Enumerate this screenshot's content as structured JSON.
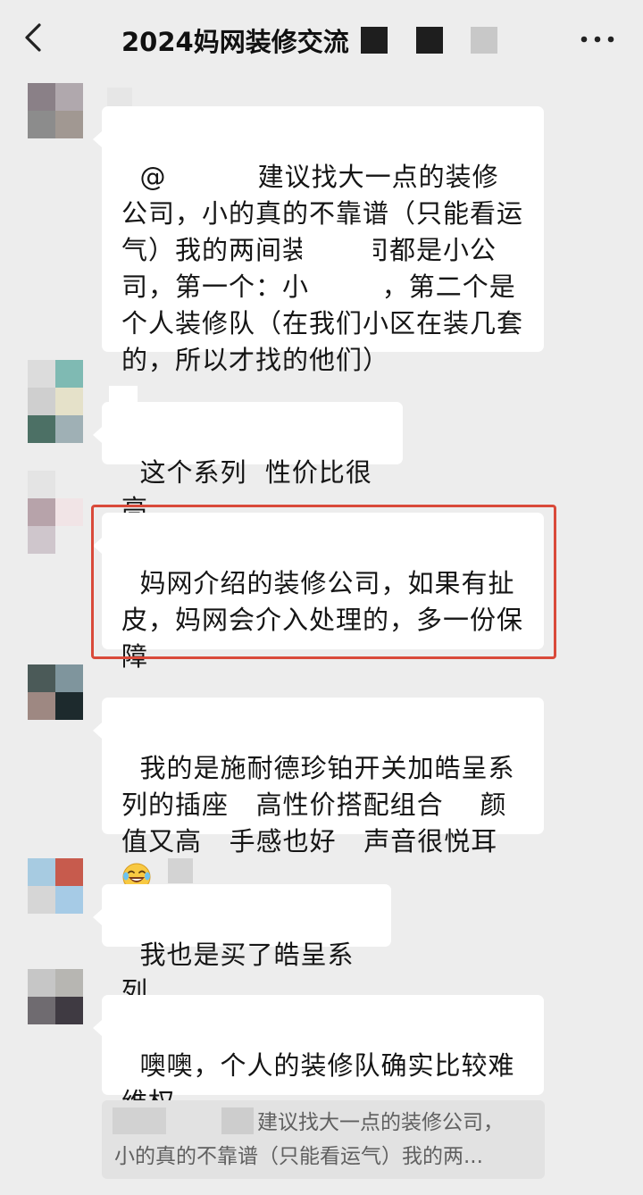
{
  "header": {
    "title": "2024妈网装修交流",
    "back_icon": "chevron-left-icon",
    "more_icon": "ellipsis-icon"
  },
  "messages": [
    {
      "text": "@          建议找大一点的装修公司，小的真的不靠谱（只能看运气）我的两间装修公司都是小公司，第一个：小        ，第二个是个人装修队（在我们小区在装几套的，所以才找的他们）"
    },
    {
      "text": "这个系列  性价比很高"
    },
    {
      "text": "妈网介绍的装修公司，如果有扯皮，妈网会介入处理的，多一份保障"
    },
    {
      "text": "我的是施耐德珍铂开关加皓呈系列的插座   高性价搭配组合    颜值又高   手感也好   声音很悦耳",
      "emoji": "laughing-tears-icon"
    },
    {
      "text": "我也是买了皓呈系列"
    },
    {
      "text": "噢噢，个人的装修队确实比较难维权"
    }
  ],
  "quote": {
    "line1": "建议找大一点的装修公司，",
    "line2": "小的真的不靠谱（只能看运气）我的两..."
  },
  "colors": {
    "background": "#ededed",
    "bubble": "#ffffff",
    "highlight": "#d94a3a",
    "quote_bg": "#e2e2e2"
  }
}
